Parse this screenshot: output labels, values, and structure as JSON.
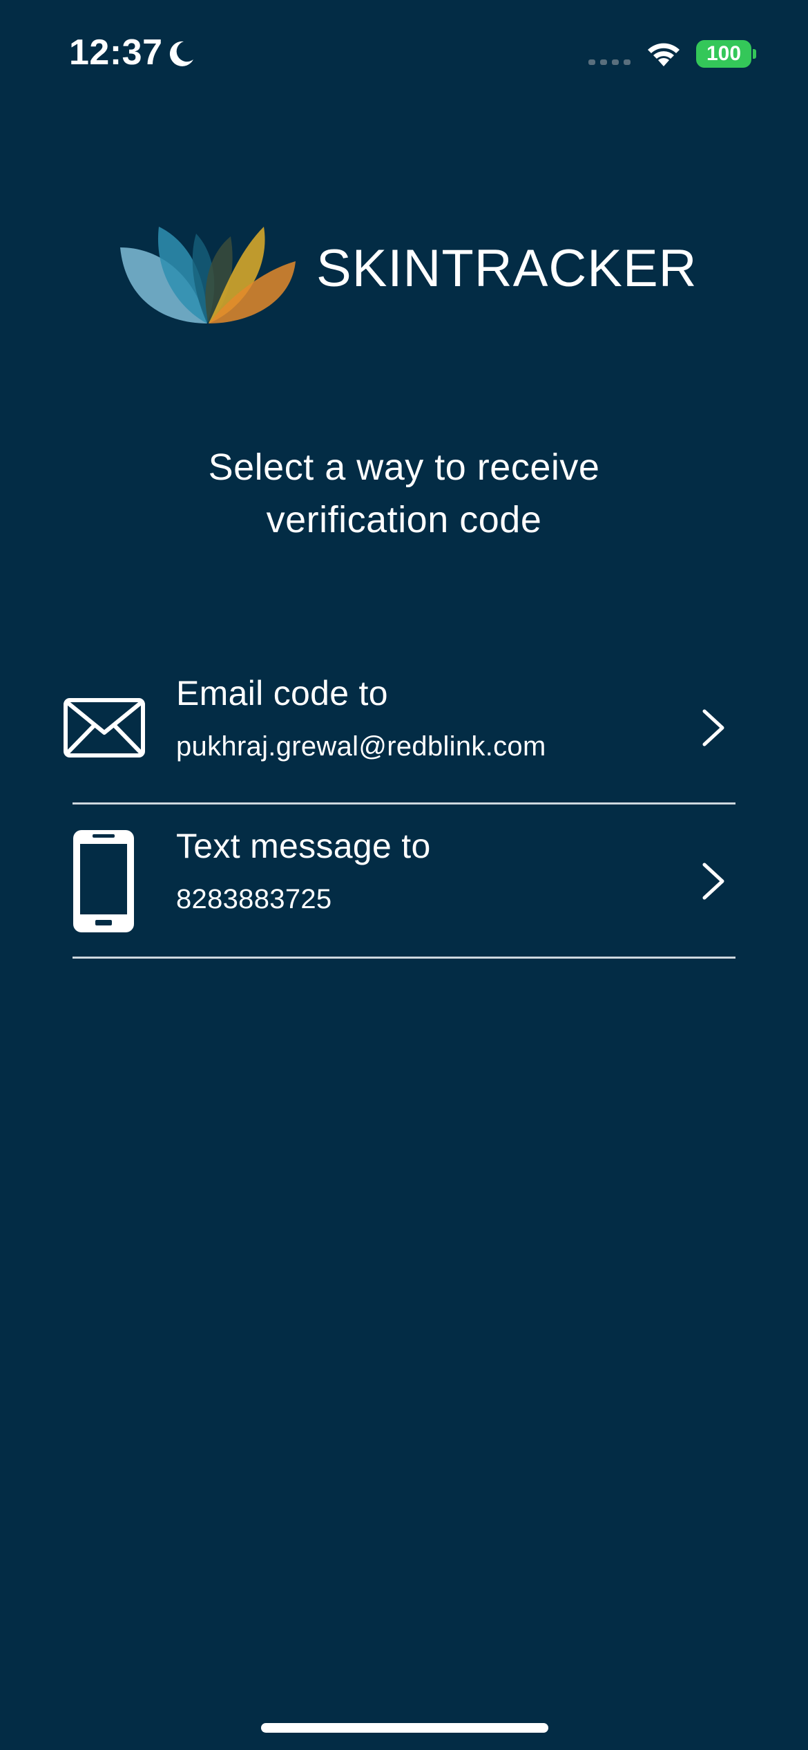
{
  "status_bar": {
    "time": "12:37",
    "battery": "100",
    "icons": [
      "moon-icon",
      "signal-icon",
      "wifi-icon",
      "battery-icon"
    ]
  },
  "logo": {
    "text": "SKINTRACKER",
    "colors": {
      "petal_blue_light": "#7fbcd6",
      "petal_blue": "#2f8fb0",
      "petal_teal": "#16607a",
      "petal_gold": "#d4a62a",
      "petal_orange": "#e38a2b"
    }
  },
  "heading": {
    "line1": "Select a way to receive",
    "line2": "verification code"
  },
  "options": [
    {
      "icon": "envelope-icon",
      "title": "Email code to",
      "detail": "pukhraj.grewal@redblink.com"
    },
    {
      "icon": "mobile-phone-icon",
      "title": "Text message to",
      "detail": "8283883725"
    }
  ],
  "colors": {
    "background": "#032c45",
    "text": "#ffffff",
    "divider": "#cfd8de",
    "battery": "#34c759"
  }
}
